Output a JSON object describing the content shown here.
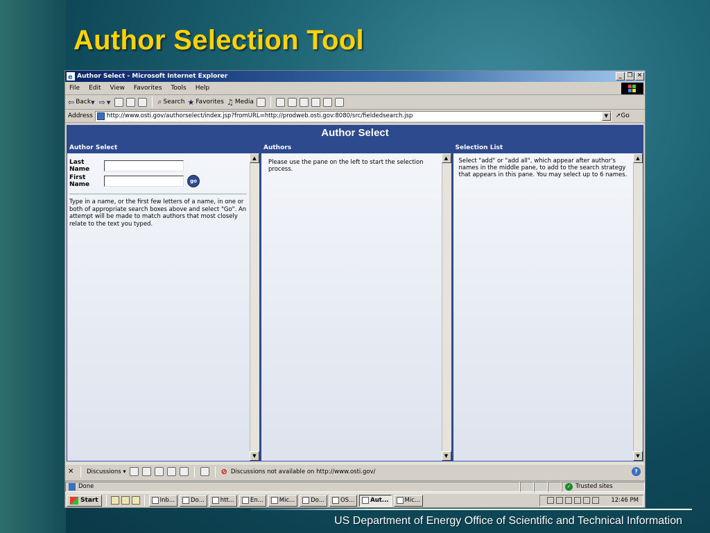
{
  "slide": {
    "title": "Author Selection Tool",
    "footer": "US Department of Energy Office of Scientific and Technical Information"
  },
  "window": {
    "title": "Author Select - Microsoft Internet Explorer",
    "controls": [
      "_",
      "❐",
      "✕"
    ]
  },
  "menu": [
    "File",
    "Edit",
    "View",
    "Favorites",
    "Tools",
    "Help"
  ],
  "toolbar": {
    "back": "Back",
    "search": "Search",
    "favorites": "Favorites",
    "media": "Media"
  },
  "address": {
    "label": "Address",
    "url": "http://www.osti.gov/authorselect/index.jsp?fromURL=http://prodweb.osti.gov:8080/src/fieldedsearch.jsp",
    "go": "Go"
  },
  "page": {
    "banner": "Author Select",
    "left_pane": {
      "header": "Author Select",
      "last_name_label": "Last Name",
      "first_name_label": "First Name",
      "go_label": "go",
      "help": "Type in a name, or the first few letters of a name, in one or both of appropriate search boxes above and select \"Go\". An attempt will be made to match authors that most closely relate to the text you typed."
    },
    "middle_pane": {
      "header": "Authors",
      "message": "Please use the pane on the left to start the selection process."
    },
    "right_pane": {
      "header": "Selection List",
      "message": "Select \"add\" or \"add all\", which appear after author's names in the middle pane, to add to the search strategy that appears in this pane. You may select up to 6 names."
    }
  },
  "discussion_bar": {
    "label": "Discussions ▾",
    "message": "Discussions not available on http://www.osti.gov/"
  },
  "status_bar": {
    "status": "Done",
    "zone": "Trusted sites"
  },
  "taskbar": {
    "start": "Start",
    "tasks": [
      "Inb...",
      "Do...",
      "htt...",
      "En...",
      "Mic...",
      "Do...",
      "OS...",
      "Aut...",
      "Mic..."
    ],
    "active_index": 7,
    "clock": "12:46 PM"
  }
}
